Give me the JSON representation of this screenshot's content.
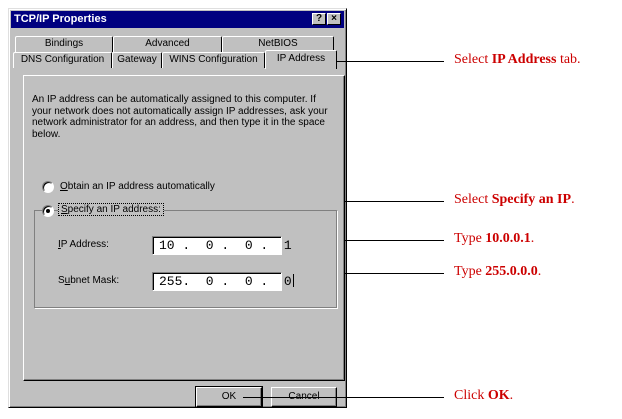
{
  "window": {
    "title": "TCP/IP Properties",
    "help_glyph": "?",
    "close_glyph": "×"
  },
  "tabs": {
    "back_row": [
      "Bindings",
      "Advanced",
      "NetBIOS"
    ],
    "front_row": [
      "DNS Configuration",
      "Gateway",
      "WINS Configuration",
      "IP Address"
    ],
    "active": "IP Address"
  },
  "panel": {
    "intro_text": "An IP address can be automatically assigned to this computer. If your network does not automatically assign IP addresses, ask your network administrator for an address, and then type it in the space below.",
    "radio_auto": {
      "label_accel": "O",
      "label_rest": "btain an IP address automatically",
      "selected": false
    },
    "radio_specify": {
      "label_accel": "S",
      "label_rest": "pecify an IP address:",
      "selected": true
    },
    "ip_address": {
      "label_accel": "I",
      "label_rest": "P Address:",
      "value": "10 .  0 .  0 .  1"
    },
    "subnet_mask": {
      "label_pre": "S",
      "label_accel": "u",
      "label_rest": "bnet Mask:",
      "value": "255.  0 .  0 .  0"
    }
  },
  "buttons": {
    "ok": "OK",
    "cancel": "Cancel"
  },
  "callouts": [
    {
      "pre": "Select ",
      "bold": "IP Address",
      "post": " tab."
    },
    {
      "pre": "Select ",
      "bold": "Specify an IP",
      "post": "."
    },
    {
      "pre": "Type ",
      "bold": "10.0.0.1",
      "post": "."
    },
    {
      "pre": "Type ",
      "bold": "255.0.0.0",
      "post": "."
    },
    {
      "pre": "Click ",
      "bold": "OK",
      "post": "."
    }
  ],
  "colors": {
    "titlebar": "#000080",
    "dialog": "#c0c0c0",
    "callout": "#cc0000"
  }
}
